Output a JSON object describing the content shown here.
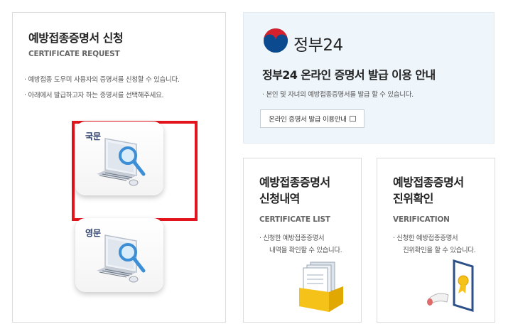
{
  "request": {
    "title": "예방접종증명서 신청",
    "subtitle": "CERTIFICATE REQUEST",
    "bullets": [
      "· 예방접종 도우미 사용자의 증명서를 신청할 수 있습니다.",
      "· 아래에서 발급하고자 하는 증명서를 선택해주세요."
    ],
    "options": [
      {
        "label": "국문",
        "icon": "computer-search-icon"
      },
      {
        "label": "영문",
        "icon": "computer-search-icon"
      }
    ],
    "highlight_color": "#e3141c"
  },
  "gov24": {
    "logo_name": "정부24",
    "title": "정부24 온라인 증명서 발급 이용 안내",
    "desc": "· 본인 및 자녀의 예방접종증명서를 발급 할 수 있습니다.",
    "button_label": "온라인 증명서 발급 이용안내"
  },
  "list": {
    "title_line1": "예방접종증명서",
    "title_line2": "신청내역",
    "subtitle": "CERTIFICATE LIST",
    "desc_line1": "· 신청한 예방접종증명서",
    "desc_line2": "내역을 확인할 수 있습니다.",
    "icon": "document-box-icon"
  },
  "verify": {
    "title_line1": "예방접종증명서",
    "title_line2": "진위확인",
    "subtitle": "VERIFICATION",
    "desc_line1": "· 신청한 예방접종증명서",
    "desc_line2": "진위확인을 할 수 있습니다.",
    "icon": "certificate-icon"
  }
}
